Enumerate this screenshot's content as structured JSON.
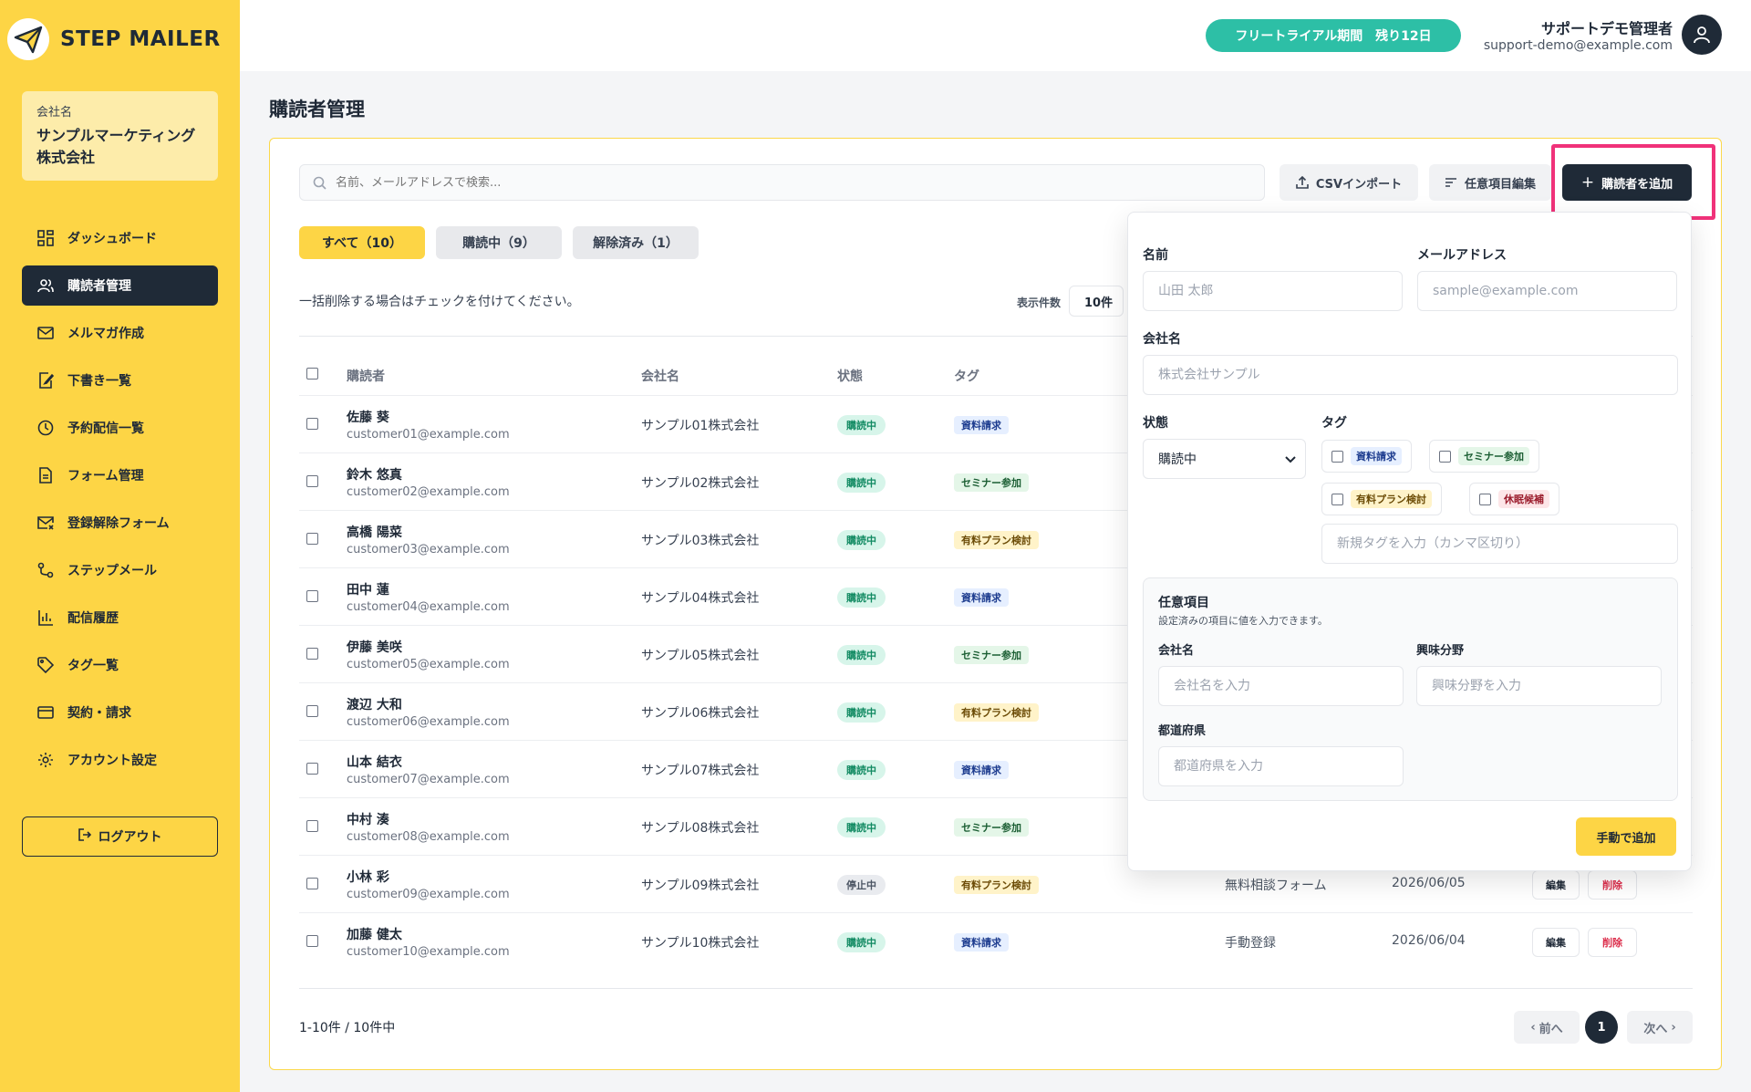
{
  "app": {
    "logo_text": "STEP MAILER"
  },
  "company": {
    "label": "会社名",
    "name_line1": "サンプルマーケティング",
    "name_line2": "株式会社"
  },
  "sidebar": {
    "items": [
      {
        "label": "ダッシュボード",
        "icon": "dashboard-icon"
      },
      {
        "label": "購読者管理",
        "icon": "users-icon",
        "active": true
      },
      {
        "label": "メルマガ作成",
        "icon": "mail-icon"
      },
      {
        "label": "下書き一覧",
        "icon": "draft-icon"
      },
      {
        "label": "予約配信一覧",
        "icon": "clock-icon"
      },
      {
        "label": "フォーム管理",
        "icon": "form-icon"
      },
      {
        "label": "登録解除フォーム",
        "icon": "mail-x-icon"
      },
      {
        "label": "ステップメール",
        "icon": "steps-icon"
      },
      {
        "label": "配信履歴",
        "icon": "chart-icon"
      },
      {
        "label": "タグ一覧",
        "icon": "tag-icon"
      },
      {
        "label": "契約・請求",
        "icon": "card-icon"
      },
      {
        "label": "アカウント設定",
        "icon": "gear-icon"
      }
    ],
    "logout_label": "ログアウト"
  },
  "header": {
    "trial_badge": "フリートライアル期間　残り12日",
    "user_name": "サポートデモ管理者",
    "user_email": "support-demo@example.com"
  },
  "page": {
    "title": "購読者管理"
  },
  "toolbar": {
    "search_placeholder": "名前、メールアドレスで検索...",
    "csv_import": "CSVインポート",
    "custom_fields": "任意項目編集",
    "add_subscriber": "購読者を追加"
  },
  "tabs": [
    {
      "label": "すべて（10）",
      "active": true
    },
    {
      "label": "購読中（9）"
    },
    {
      "label": "解除済み（1）"
    }
  ],
  "list": {
    "hint": "一括削除する場合はチェックを付けてください。",
    "per_page_label": "表示件数",
    "per_page_value": "10件",
    "headers": {
      "subscriber": "購読者",
      "company": "会社名",
      "status": "状態",
      "tag": "タグ"
    },
    "edit_label": "編集",
    "delete_label": "削除",
    "rows": [
      {
        "name": "佐藤 葵",
        "email": "customer01@example.com",
        "company": "サンプル01株式会社",
        "status": "購読中",
        "tag": "資料請求"
      },
      {
        "name": "鈴木 悠真",
        "email": "customer02@example.com",
        "company": "サンプル02株式会社",
        "status": "購読中",
        "tag": "セミナー参加"
      },
      {
        "name": "高橋 陽菜",
        "email": "customer03@example.com",
        "company": "サンプル03株式会社",
        "status": "購読中",
        "tag": "有料プラン検討"
      },
      {
        "name": "田中 蓮",
        "email": "customer04@example.com",
        "company": "サンプル04株式会社",
        "status": "購読中",
        "tag": "資料請求"
      },
      {
        "name": "伊藤 美咲",
        "email": "customer05@example.com",
        "company": "サンプル05株式会社",
        "status": "購読中",
        "tag": "セミナー参加"
      },
      {
        "name": "渡辺 大和",
        "email": "customer06@example.com",
        "company": "サンプル06株式会社",
        "status": "購読中",
        "tag": "有料プラン検討"
      },
      {
        "name": "山本 結衣",
        "email": "customer07@example.com",
        "company": "サンプル07株式会社",
        "status": "購読中",
        "tag": "資料請求"
      },
      {
        "name": "中村 湊",
        "email": "customer08@example.com",
        "company": "サンプル08株式会社",
        "status": "購読中",
        "tag": "セミナー参加"
      },
      {
        "name": "小林 彩",
        "email": "customer09@example.com",
        "company": "サンプル09株式会社",
        "status": "停止中",
        "tag": "有料プラン検討",
        "source": "無料相談フォーム",
        "date": "2026/06/05"
      },
      {
        "name": "加藤 健太",
        "email": "customer10@example.com",
        "company": "サンプル10株式会社",
        "status": "購読中",
        "tag": "資料請求",
        "source": "手動登録",
        "date": "2026/06/04"
      }
    ]
  },
  "pagination": {
    "range": "1-10件 / 10件中",
    "prev": "前へ",
    "current": "1",
    "next": "次へ"
  },
  "add_form": {
    "name_label": "名前",
    "name_placeholder": "山田 太郎",
    "email_label": "メールアドレス",
    "email_placeholder": "sample@example.com",
    "company_label": "会社名",
    "company_placeholder": "株式会社サンプル",
    "status_label": "状態",
    "status_value": "購読中",
    "tag_label": "タグ",
    "tags": [
      "資料請求",
      "セミナー参加",
      "有料プラン検討",
      "休眠候補"
    ],
    "new_tag_placeholder": "新規タグを入力（カンマ区切り）",
    "custom_title": "任意項目",
    "custom_desc": "設定済みの項目に値を入力できます。",
    "custom_company_label": "会社名",
    "custom_company_placeholder": "会社名を入力",
    "interest_label": "興味分野",
    "interest_placeholder": "興味分野を入力",
    "pref_label": "都道府県",
    "pref_placeholder": "都道府県を入力",
    "submit": "手動で追加"
  },
  "colors": {
    "brand_yellow": "#fdd545",
    "dark": "#1f2a37",
    "trial_green": "#2dbfa6",
    "highlight_pink": "#f0327a"
  }
}
